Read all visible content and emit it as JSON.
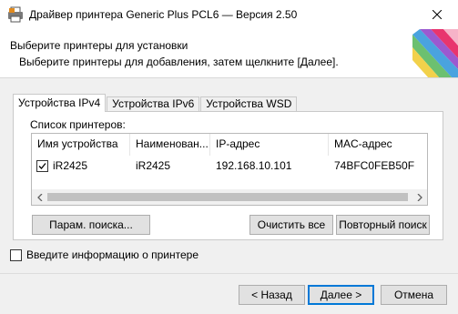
{
  "window": {
    "title": "Драйвер принтера Generic Plus PCL6 — Версия 2.50"
  },
  "header": {
    "title": "Выберите принтеры для установки",
    "subtitle": "Выберите принтеры для добавления, затем щелкните [Далее]."
  },
  "tabs": [
    {
      "label": "Устройства IPv4",
      "active": true
    },
    {
      "label": "Устройства IPv6",
      "active": false
    },
    {
      "label": "Устройства WSD",
      "active": false
    }
  ],
  "printer_list": {
    "label": "Список принтеров:",
    "columns": [
      "Имя устройства",
      "Наименован...",
      "IP-адрес",
      "MAC-адрес"
    ],
    "rows": [
      {
        "checked": true,
        "device_name": "iR2425",
        "product_name": "iR2425",
        "ip": "192.168.10.101",
        "mac": "74BFC0FEB50F"
      }
    ]
  },
  "buttons": {
    "search_params": "Парам. поиска...",
    "clear_all": "Очистить все",
    "search_again": "Повторный поиск",
    "back": "< Назад",
    "next": "Далее >",
    "cancel": "Отмена"
  },
  "enter_info": {
    "label": "Введите информацию о принтере",
    "checked": false
  },
  "colors": {
    "accent": "#0078d7",
    "button_bg": "#e1e1e1",
    "window_bg": "#f0f0f0"
  },
  "icons": [
    "printer-app-icon",
    "close-icon",
    "checkmark-icon",
    "arrow-left-icon",
    "arrow-right-icon"
  ]
}
